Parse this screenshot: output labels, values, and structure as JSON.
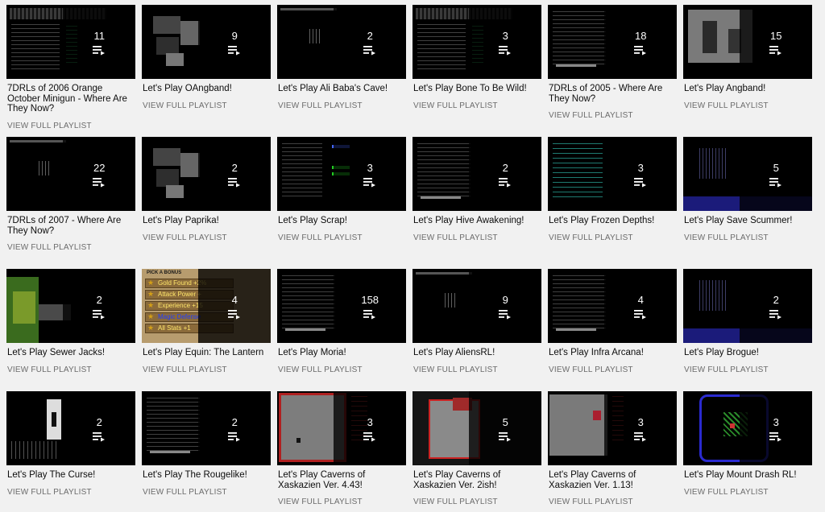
{
  "playlists": [
    {
      "title": "7DRLs of 2006 Orange October Minigun - Where Are They Now?",
      "count": "11",
      "action": "VIEW FULL PLAYLIST",
      "thumb": "banner"
    },
    {
      "title": "Let's Play OAngband!",
      "count": "9",
      "action": "VIEW FULL PLAYLIST",
      "thumb": "blocks"
    },
    {
      "title": "Let's Play Ali Baba's Cave!",
      "count": "2",
      "action": "VIEW FULL PLAYLIST",
      "thumb": "dark"
    },
    {
      "title": "Let's Play Bone To Be Wild!",
      "count": "3",
      "action": "VIEW FULL PLAYLIST",
      "thumb": "banner"
    },
    {
      "title": "7DRLs of 2005 - Where Are They Now?",
      "count": "18",
      "action": "VIEW FULL PLAYLIST",
      "thumb": "text"
    },
    {
      "title": "Let's Play Angband!",
      "count": "15",
      "action": "VIEW FULL PLAYLIST",
      "thumb": "gray"
    },
    {
      "title": "7DRLs of 2007 - Where Are They Now?",
      "count": "22",
      "action": "VIEW FULL PLAYLIST",
      "thumb": "dark"
    },
    {
      "title": "Let's Play Paprika!",
      "count": "2",
      "action": "VIEW FULL PLAYLIST",
      "thumb": "blocks"
    },
    {
      "title": "Let's Play Scrap!",
      "count": "3",
      "action": "VIEW FULL PLAYLIST",
      "thumb": "green"
    },
    {
      "title": "Let's Play Hive Awakening!",
      "count": "2",
      "action": "VIEW FULL PLAYLIST",
      "thumb": "text"
    },
    {
      "title": "Let's Play Frozen Depths!",
      "count": "3",
      "action": "VIEW FULL PLAYLIST",
      "thumb": "cyan"
    },
    {
      "title": "Let's Play Save Scummer!",
      "count": "5",
      "action": "VIEW FULL PLAYLIST",
      "thumb": "blue"
    },
    {
      "title": "Let's Play Sewer Jacks!",
      "count": "2",
      "action": "VIEW FULL PLAYLIST",
      "thumb": "forest"
    },
    {
      "title": "Let's Play Equin: The Lantern",
      "count": "4",
      "action": "VIEW FULL PLAYLIST",
      "thumb": "bonus"
    },
    {
      "title": "Let's Play Moria!",
      "count": "158",
      "action": "VIEW FULL PLAYLIST",
      "thumb": "text"
    },
    {
      "title": "Let's Play AliensRL!",
      "count": "9",
      "action": "VIEW FULL PLAYLIST",
      "thumb": "dark"
    },
    {
      "title": "Let's Play Infra Arcana!",
      "count": "4",
      "action": "VIEW FULL PLAYLIST",
      "thumb": "text"
    },
    {
      "title": "Let's Play Brogue!",
      "count": "2",
      "action": "VIEW FULL PLAYLIST",
      "thumb": "blue"
    },
    {
      "title": "Let's Play The Curse!",
      "count": "2",
      "action": "VIEW FULL PLAYLIST",
      "thumb": "curse"
    },
    {
      "title": "Let's Play The Rougelike!",
      "count": "2",
      "action": "VIEW FULL PLAYLIST",
      "thumb": "text"
    },
    {
      "title": "Let's Play Caverns of Xaskazien Ver. 4.43!",
      "count": "3",
      "action": "VIEW FULL PLAYLIST",
      "thumb": "redbox"
    },
    {
      "title": "Let's Play Caverns of Xaskazien Ver. 2ish!",
      "count": "5",
      "action": "VIEW FULL PLAYLIST",
      "thumb": "redmap"
    },
    {
      "title": "Let's Play Caverns of Xaskazien Ver. 1.13!",
      "count": "3",
      "action": "VIEW FULL PLAYLIST",
      "thumb": "graybox"
    },
    {
      "title": "Let's Play Mount Drash RL!",
      "count": "3",
      "action": "VIEW FULL PLAYLIST",
      "thumb": "drash"
    }
  ],
  "bonus_menu": {
    "header": "PICK A BONUS",
    "items": [
      "Gold Found +2%",
      "Attack Power +",
      "Experience +15",
      "Magic Defense",
      "All Stats +1"
    ]
  },
  "colors": {
    "background": "#f1f1f1",
    "title_text": "#0d0d0d",
    "secondary_text": "#6b6b6b",
    "thumb_bg": "#000000"
  }
}
